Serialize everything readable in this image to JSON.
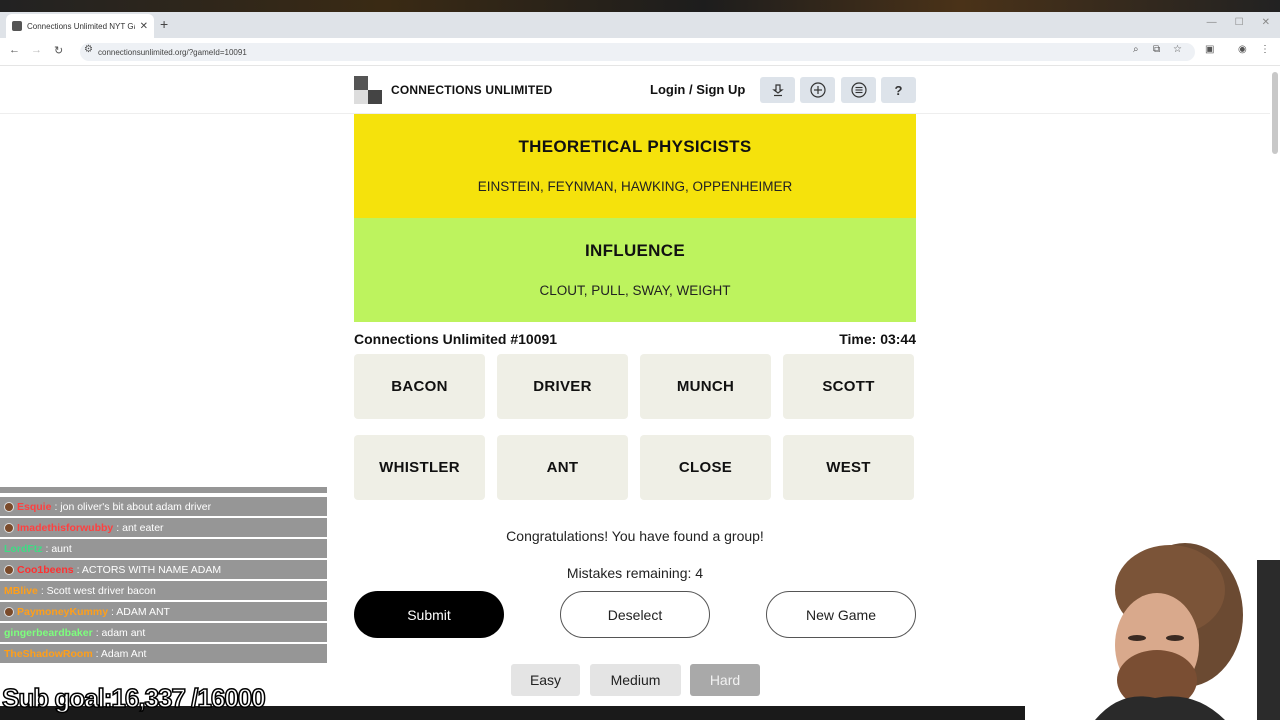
{
  "browser": {
    "tab_title": "Connections Unlimited NYT Ga",
    "tab_close": "✕",
    "new_tab": "+",
    "url": "connectionsunlimited.org/?gameId=10091"
  },
  "header": {
    "brand": "CONNECTIONS UNLIMITED",
    "login": "Login / Sign Up",
    "icons": [
      "leaderboard-icon",
      "add-icon",
      "menu-icon",
      "help-icon"
    ],
    "help_label": "?"
  },
  "groups": [
    {
      "name": "THEORETICAL PHYSICISTS",
      "words": "EINSTEIN, FEYNMAN, HAWKING, OPPENHEIMER",
      "color": "#f5e20c"
    },
    {
      "name": "INFLUENCE",
      "words": "CLOUT, PULL, SWAY, WEIGHT",
      "color": "#bdf35e"
    }
  ],
  "game": {
    "id_label": "Connections Unlimited #10091",
    "timer": "Time: 03:44",
    "tiles": [
      "BACON",
      "DRIVER",
      "MUNCH",
      "SCOTT",
      "WHISTLER",
      "ANT",
      "CLOSE",
      "WEST"
    ],
    "message": "Congratulations! You have found a group!",
    "mistakes": "Mistakes remaining: 4"
  },
  "buttons": {
    "submit": "Submit",
    "deselect": "Deselect",
    "new_game": "New Game"
  },
  "difficulty": {
    "options": [
      "Easy",
      "Medium",
      "Hard"
    ],
    "selected": "Hard"
  },
  "chat": [
    {
      "user": "Esquie",
      "text": ": jon oliver's bit about adam driver",
      "color": "#ff4040"
    },
    {
      "user": "Imadethisforwubby",
      "text": ": ant eater",
      "color": "#ff4040"
    },
    {
      "user": "LordFtz",
      "text": ": aunt",
      "color": "#3ddc84"
    },
    {
      "user": "Coo1beens",
      "text": ": ACTORS WITH NAME ADAM",
      "color": "#ff3030"
    },
    {
      "user": "MBlive",
      "text": ": Scott west driver bacon",
      "color": "#ff9f1a"
    },
    {
      "user": "PaymoneyKummy",
      "text": ": ADAM ANT",
      "color": "#ff9f1a"
    },
    {
      "user": "gingerbeardbaker",
      "text": ": adam ant",
      "color": "#7dff7d"
    },
    {
      "user": "TheShadowRoom",
      "text": ": Adam Ant",
      "color": "#ff9f1a"
    }
  ],
  "overlay": {
    "sub_goal": "Sub goal:16,337 /16000"
  }
}
